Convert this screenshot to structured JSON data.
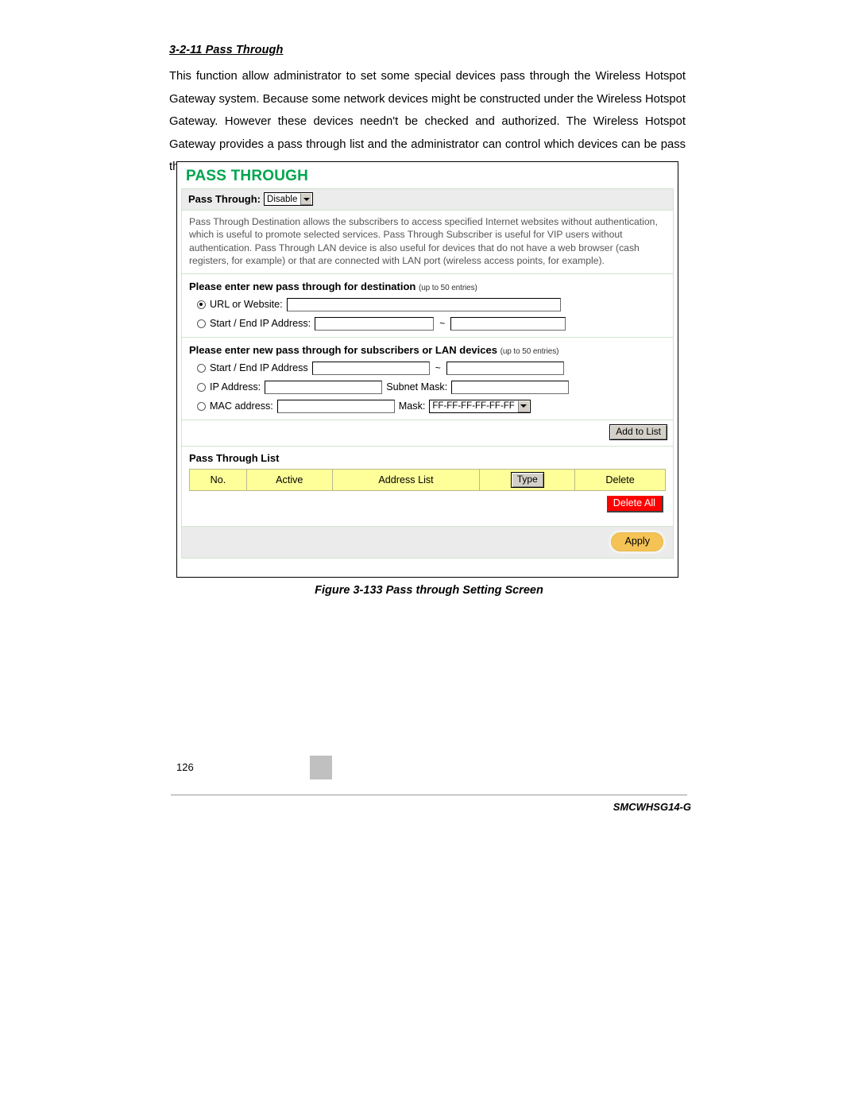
{
  "document": {
    "heading": "3-2-11 Pass Through",
    "body": "This function allow administrator to set some special devices pass through the Wireless Hotspot Gateway system. Because some network devices might be constructed under the Wireless Hotspot Gateway. However these devices needn't be checked and authorized. The Wireless Hotspot Gateway provides a pass through list and the administrator can control which devices can be pass through with authentication.",
    "caption": "Figure 3-133 Pass through Setting Screen",
    "page_number": "126",
    "model": "SMCWHSG14-G"
  },
  "screenshot": {
    "title": "PASS THROUGH",
    "enable_row": {
      "label": "Pass Through:",
      "select_value": "Disable"
    },
    "description": "Pass Through Destination allows the subscribers to access specified Internet websites without authentication, which is useful to promote selected services. Pass Through Subscriber is useful for VIP users without authentication. Pass Through LAN device is also useful for devices that do not have a web browser (cash registers, for example) or that are connected with LAN port (wireless access points, for example).",
    "destination_section": {
      "title": "Please enter new pass through for destination",
      "title_note": "(up to 50 entries)",
      "rows": [
        {
          "radio_label": "URL or Website:",
          "selected": "true",
          "value": "",
          "second_value": ""
        },
        {
          "radio_label": "Start / End IP Address:",
          "selected": "false",
          "value": "",
          "separator": "~",
          "second_value": ""
        }
      ]
    },
    "subscriber_section": {
      "title": "Please enter new pass through for subscribers or LAN devices",
      "title_note": "(up to 50 entries)",
      "rows": [
        {
          "radio_label": "Start / End IP Address",
          "selected": "false",
          "value": "",
          "separator": "~",
          "second_value": ""
        },
        {
          "radio_label": "IP Address:",
          "selected": "false",
          "value": "",
          "second_label": "Subnet Mask:",
          "second_value": ""
        },
        {
          "radio_label": "MAC address:",
          "selected": "false",
          "value": "",
          "second_label": "Mask:",
          "mask_select_value": "FF-FF-FF-FF-FF-FF"
        }
      ]
    },
    "add_to_list_label": "Add to List",
    "list_section": {
      "title": "Pass Through List",
      "columns": [
        "No.",
        "Active",
        "Address List",
        "Type",
        "Delete"
      ],
      "rows": []
    },
    "delete_all_label": "Delete All",
    "apply_label": "Apply",
    "colors": {
      "title_green": "#00a54f",
      "table_header_yellow": "#ffff99",
      "delete_red": "#ff0000",
      "apply_gold": "#f5c355"
    }
  }
}
